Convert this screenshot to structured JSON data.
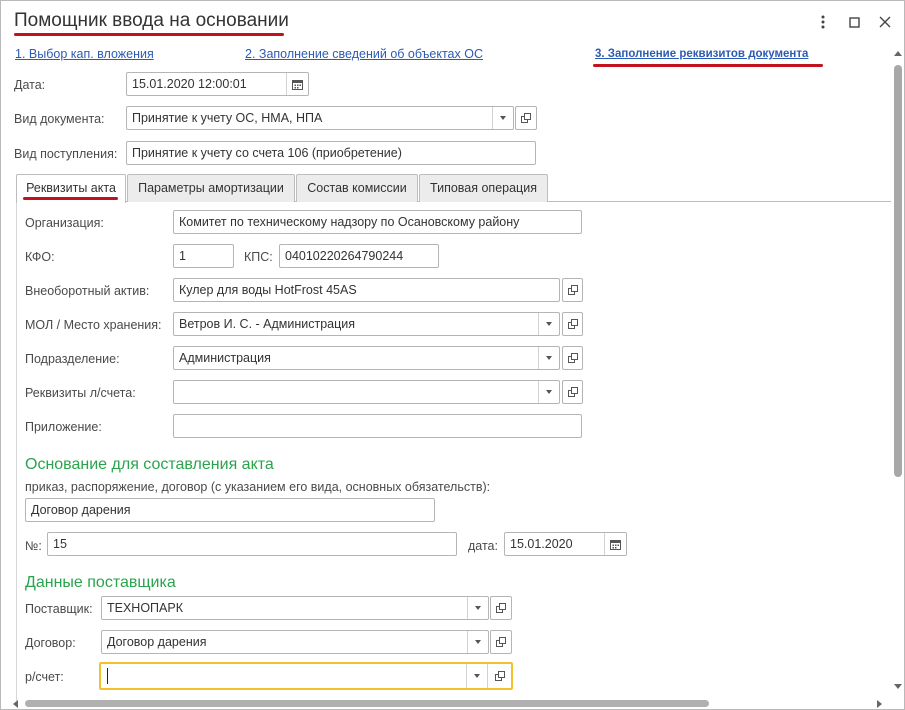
{
  "window": {
    "title": "Помощник ввода на основании"
  },
  "steps": [
    {
      "label": "1. Выбор кап. вложения"
    },
    {
      "label": "2. Заполнение сведений об объектах ОС"
    },
    {
      "label": "3. Заполнение реквизитов документа"
    }
  ],
  "header": {
    "date_label": "Дата:",
    "date_value": "15.01.2020 12:00:01",
    "doc_type_label": "Вид документа:",
    "doc_type_value": "Принятие к учету ОС, НМА, НПА",
    "receipt_type_label": "Вид поступления:",
    "receipt_type_value": "Принятие к учету со счета 106 (приобретение)"
  },
  "tabs": [
    {
      "label": "Реквизиты акта"
    },
    {
      "label": "Параметры амортизации"
    },
    {
      "label": "Состав комиссии"
    },
    {
      "label": "Типовая операция"
    }
  ],
  "act": {
    "org_label": "Организация:",
    "org_value": "Комитет по техническому надзору по Осановскому району",
    "kfo_label": "КФО:",
    "kfo_value": "1",
    "kps_label": "КПС:",
    "kps_value": "04010220264790244",
    "asset_label": "Внеоборотный актив:",
    "asset_value": "Кулер  для воды HotFrost 45AS",
    "mol_label": "МОЛ / Место хранения:",
    "mol_value": "Ветров И. С. - Администрация",
    "dept_label": "Подразделение:",
    "dept_value": "Администрация",
    "account_label": "Реквизиты л/счета:",
    "account_value": "",
    "attachment_label": "Приложение:",
    "attachment_value": ""
  },
  "basis": {
    "heading": "Основание для составления акта",
    "hint": "приказ, распоряжение, договор (с указанием его вида, основных обязательств):",
    "basis_value": "Договор дарения",
    "number_label": "№:",
    "number_value": "15",
    "date_label": "дата:",
    "date_value": "15.01.2020"
  },
  "supplier": {
    "heading": "Данные поставщика",
    "supplier_label": "Поставщик:",
    "supplier_value": "ТЕХНОПАРК",
    "contract_label": "Договор:",
    "contract_value": "Договор дарения",
    "account_label": "р/счет:",
    "account_value": ""
  },
  "icons": {
    "more": "more-vertical-icon",
    "maximize": "maximize-icon",
    "close": "close-icon",
    "calendar": "calendar-icon",
    "open": "open-form-icon",
    "dropdown": "chevron-down-icon"
  },
  "colors": {
    "accent_underline": "#c2121e",
    "link": "#2c5bb3",
    "section_heading": "#2aa44c",
    "focus_border": "#f4c12d"
  }
}
